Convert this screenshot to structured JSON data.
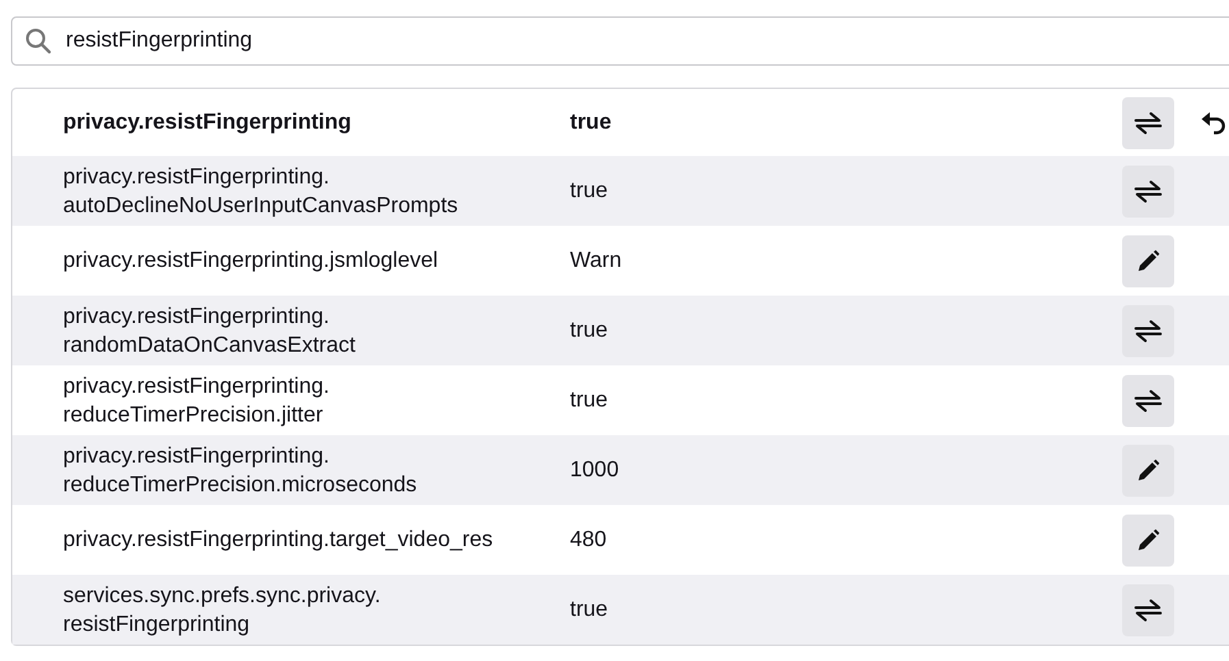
{
  "search": {
    "value": "resistFingerprinting"
  },
  "prefs": [
    {
      "name": "privacy.resistFingerprinting",
      "value": "true",
      "modified": true,
      "kind": "toggle"
    },
    {
      "name": "privacy.resistFingerprinting.\nautoDeclineNoUserInputCanvasPrompts",
      "value": "true",
      "modified": false,
      "kind": "toggle"
    },
    {
      "name": "privacy.resistFingerprinting.jsmloglevel",
      "value": "Warn",
      "modified": false,
      "kind": "edit"
    },
    {
      "name": "privacy.resistFingerprinting.\nrandomDataOnCanvasExtract",
      "value": "true",
      "modified": false,
      "kind": "toggle"
    },
    {
      "name": "privacy.resistFingerprinting.\nreduceTimerPrecision.jitter",
      "value": "true",
      "modified": false,
      "kind": "toggle"
    },
    {
      "name": "privacy.resistFingerprinting.\nreduceTimerPrecision.microseconds",
      "value": "1000",
      "modified": false,
      "kind": "edit"
    },
    {
      "name": "privacy.resistFingerprinting.target_video_res",
      "value": "480",
      "modified": false,
      "kind": "edit"
    },
    {
      "name": "services.sync.prefs.sync.privacy.\nresistFingerprinting",
      "value": "true",
      "modified": false,
      "kind": "toggle"
    }
  ]
}
